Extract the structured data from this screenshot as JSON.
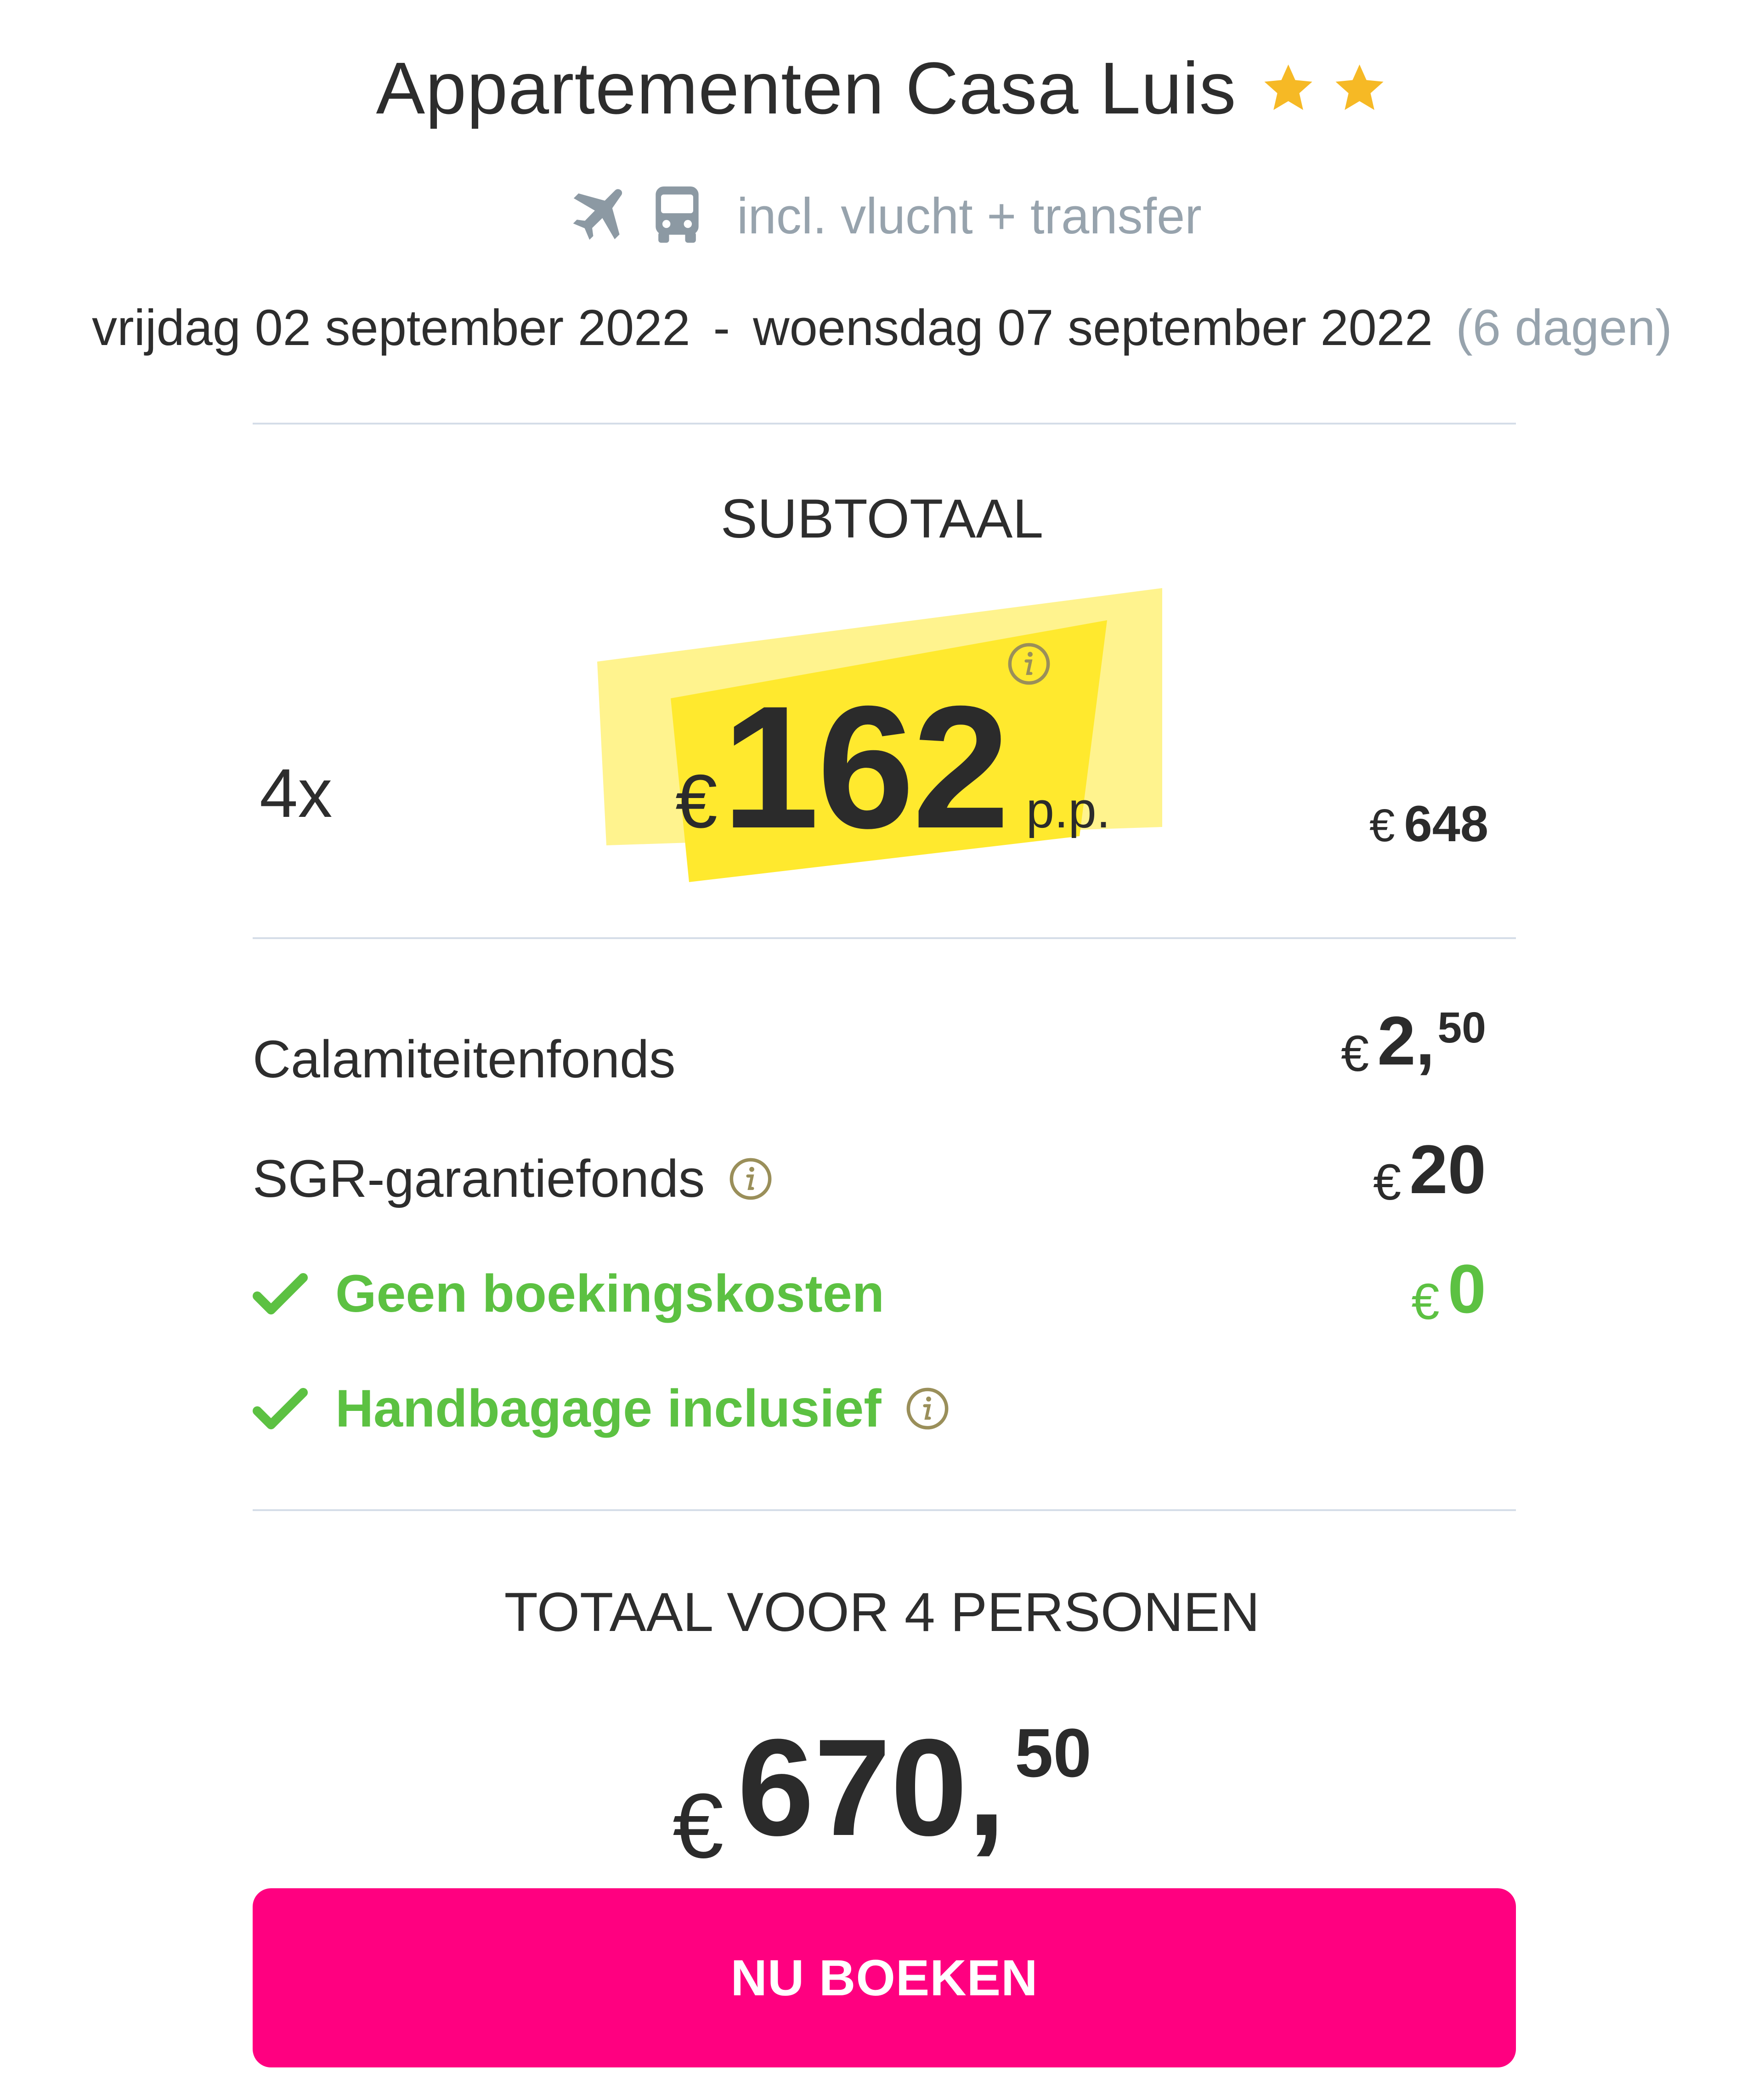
{
  "header": {
    "title": "Appartementen Casa Luis",
    "star_count": 2,
    "star_color": "#f6b925",
    "icons": [
      "plane-icon",
      "bus-icon"
    ],
    "subtitle": "incl. vlucht + transfer"
  },
  "dates": {
    "start": "vrijdag 02 september 2022",
    "separator": "-",
    "end": "woensdag 07 september 2022",
    "duration": "(6 dagen)"
  },
  "subtotal": {
    "heading": "SUBTOTAAL",
    "quantity": "4x",
    "currency": "€",
    "price_per_person": "162",
    "pp_label": "p.p.",
    "total_currency": "€",
    "total": "648",
    "highlight_color": "#ffe92e"
  },
  "fees": [
    {
      "label": "Calamiteitenfonds",
      "currency": "€",
      "integer": "2,",
      "decimal": "50"
    },
    {
      "label": "SGR-garantiefonds",
      "currency": "€",
      "integer": "20",
      "decimal": ""
    },
    {
      "label": "Geen boekingskosten",
      "currency": "€",
      "integer": "0",
      "decimal": ""
    },
    {
      "label": "Handbagage inclusief"
    }
  ],
  "total": {
    "heading": "TOTAAL VOOR 4 PERSONEN",
    "currency": "€",
    "integer": "670,",
    "decimal": "50"
  },
  "cta": {
    "label": "NU BOEKEN",
    "color": "#ff0080"
  }
}
